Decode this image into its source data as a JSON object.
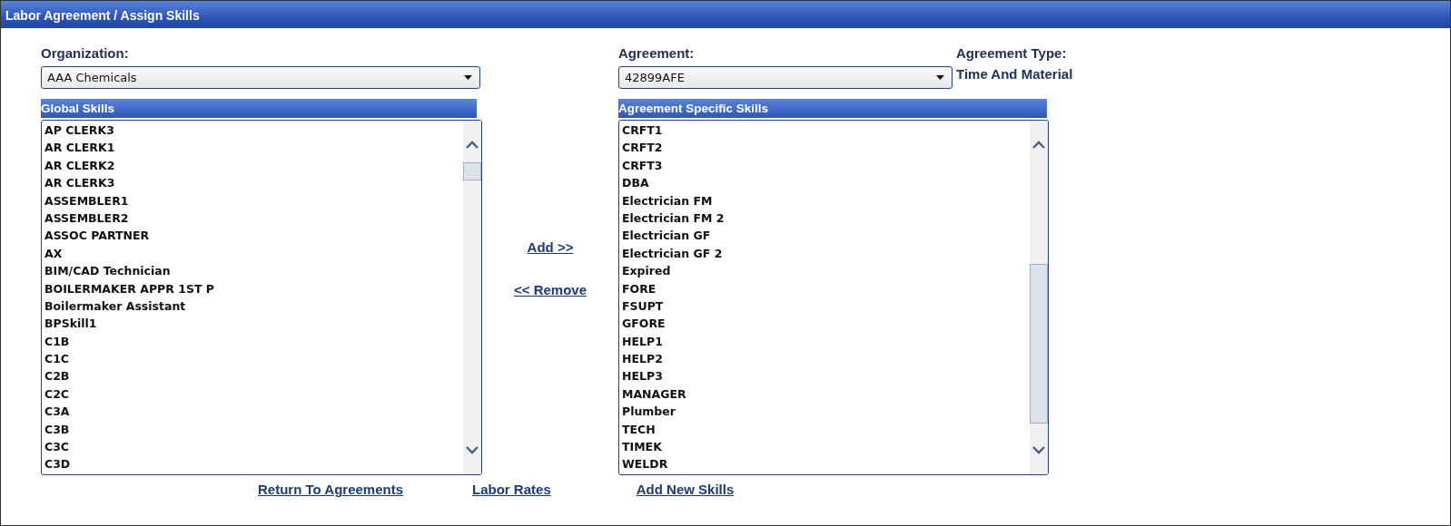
{
  "window": {
    "title": "Labor Agreement / Assign Skills"
  },
  "organization": {
    "label": "Organization:",
    "value": "AAA Chemicals"
  },
  "agreement": {
    "label": "Agreement:",
    "value": "42899AFE"
  },
  "agreement_type": {
    "label": "Agreement Type:",
    "value": "Time And Material"
  },
  "global_skills": {
    "title": "Global Skills",
    "items": [
      "AP CLERK3",
      "AR CLERK1",
      "AR CLERK2",
      "AR CLERK3",
      "ASSEMBLER1",
      "ASSEMBLER2",
      "ASSOC PARTNER",
      "AX",
      "BIM/CAD Technician",
      "BOILERMAKER APPR 1ST P",
      "Boilermaker Assistant",
      "BPSkill1",
      "C1B",
      "C1C",
      "C2B",
      "C2C",
      "C3A",
      "C3B",
      "C3C",
      "C3D"
    ]
  },
  "specific_skills": {
    "title": "Agreement Specific Skills",
    "items": [
      "CRFT1",
      "CRFT2",
      "CRFT3",
      "DBA",
      "Electrician FM",
      "Electrician FM 2",
      "Electrician GF",
      "Electrician GF 2",
      "Expired",
      "FORE",
      "FSUPT",
      "GFORE",
      "HELP1",
      "HELP2",
      "HELP3",
      "MANAGER",
      "Plumber",
      "TECH",
      "TIMEK",
      "WELDR"
    ]
  },
  "actions": [
    "Add >>",
    "<< Remove"
  ],
  "footer_links": [
    "Return To Agreements",
    "Labor Rates",
    "Add New Skills"
  ]
}
